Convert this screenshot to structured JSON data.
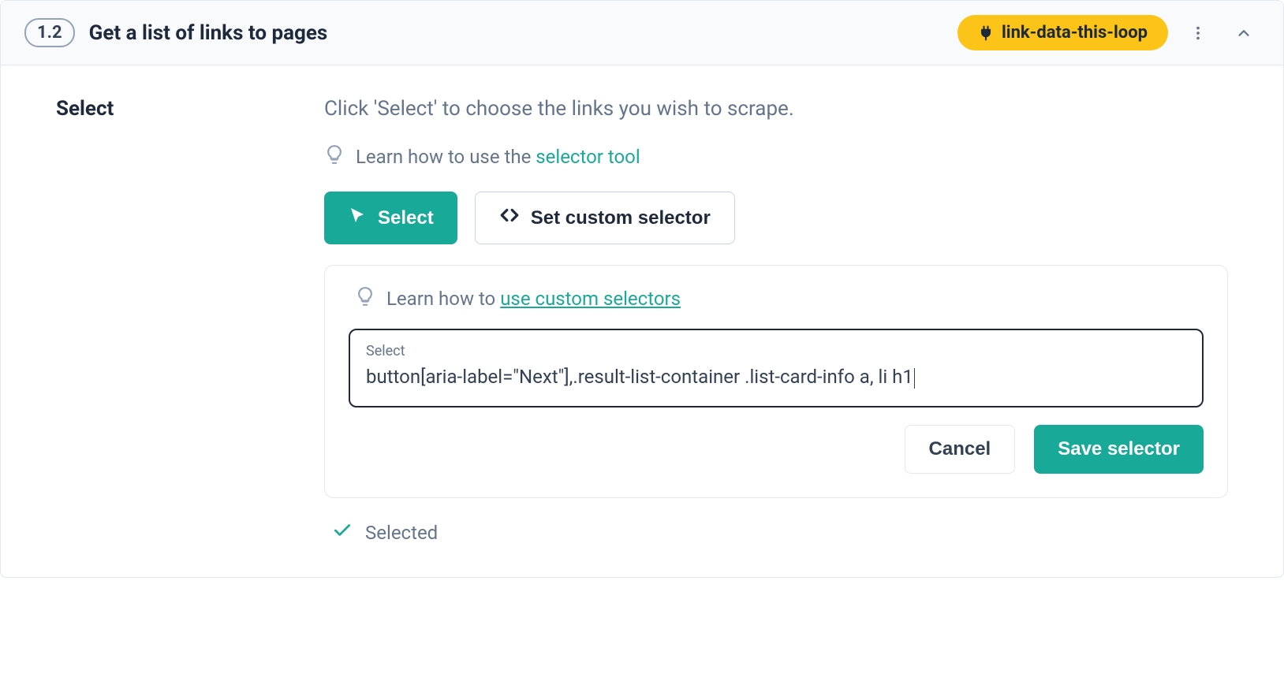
{
  "header": {
    "step_number": "1.2",
    "title": "Get a list of links to pages",
    "tag_label": "link-data-this-loop"
  },
  "section": {
    "label": "Select",
    "instruction": "Click 'Select' to choose the links you wish to scrape.",
    "hint_prefix": "Learn how to use the ",
    "hint_link": "selector tool"
  },
  "buttons": {
    "select": "Select",
    "set_custom": "Set custom selector"
  },
  "custom_panel": {
    "hint_prefix": "Learn how to ",
    "hint_link": "use custom selectors",
    "input_label": "Select",
    "input_value": "button[aria-label=\"Next\"],.result-list-container .list-card-info a, li h1",
    "cancel": "Cancel",
    "save": "Save selector"
  },
  "status": {
    "selected": "Selected"
  }
}
